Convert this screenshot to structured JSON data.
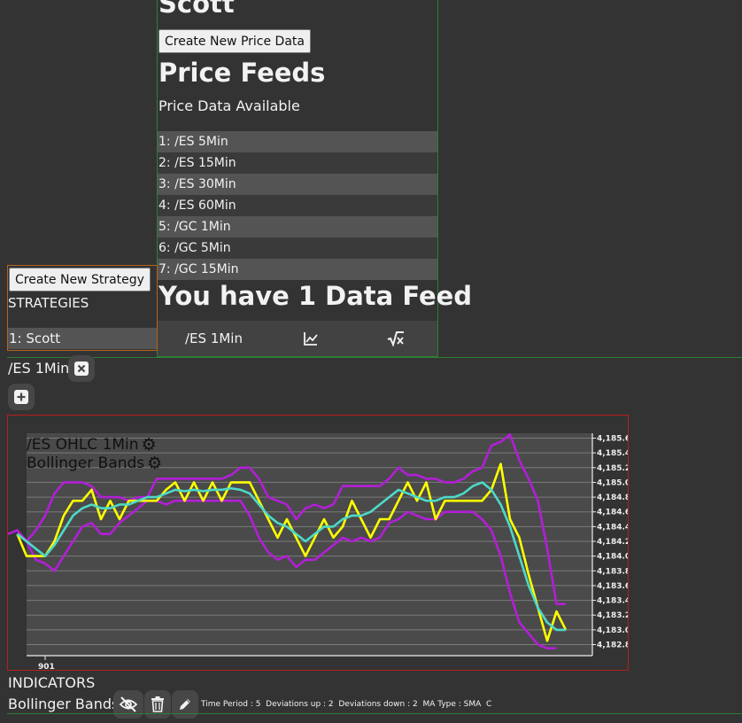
{
  "feeds": {
    "title_partial": "Scott",
    "create_button": "Create New Price Data",
    "heading": "Price Feeds",
    "subheading": "Price Data Available",
    "items": [
      "1: /ES 5Min",
      "2: /ES 15Min",
      "3: /ES 30Min",
      "4: /ES 60Min",
      "5: /GC 1Min",
      "6: /GC 5Min",
      "7: /GC 15Min"
    ],
    "count_heading": "You have 1 Data Feed",
    "active_feed": "/ES 1Min"
  },
  "strategies": {
    "create_button": "Create New Strategy",
    "heading": "STRATEGIES",
    "items": [
      "1: Scott"
    ]
  },
  "workspace": {
    "tab_label": "/ES 1Min"
  },
  "chart_labels": {
    "series_label": "/ES OHLC 1Min",
    "indicator_label": "Bollinger Bands",
    "x_tick": "901"
  },
  "indicators": {
    "heading": "INDICATORS",
    "name": "Bollinger Bands",
    "params": "Time Period : 5  Deviations up : 2  Deviations down : 2  MA Type : SMA  C"
  },
  "colors": {
    "price": "#ffff00",
    "middle": "#4dd9c8",
    "bands": "#b21fd6",
    "grid": "#7a7a7a",
    "plot_bg": "#4a4a4a"
  },
  "chart_data": {
    "type": "line",
    "yticks": [
      "4,185.6",
      "4,185.4",
      "4,185.2",
      "4,185.0",
      "4,184.8",
      "4,184.6",
      "4,184.4",
      "4,184.2",
      "4,184.0",
      "4,183.8",
      "4,183.6",
      "4,183.4",
      "4,183.2",
      "4,183.0",
      "4,182.8"
    ],
    "ylim": [
      4182.75,
      4185.65
    ],
    "xlim": [
      0,
      61
    ],
    "x_tick_value": 4,
    "series": [
      {
        "values": [
          4184.3,
          4184.0,
          4184.0,
          4184.0,
          4184.2,
          4184.55,
          4184.75,
          4184.75,
          4184.9,
          4184.5,
          4184.75,
          4184.5,
          4184.75,
          4184.75,
          4184.75,
          4184.75,
          4184.9,
          4185.0,
          4184.75,
          4185.0,
          4184.75,
          4185.0,
          4184.75,
          4185.0,
          4185.0,
          4185.0,
          4184.75,
          4184.5,
          4184.25,
          4184.5,
          4184.25,
          4184.0,
          4184.25,
          4184.5,
          4184.25,
          4184.4,
          4184.75,
          4184.5,
          4184.25,
          4184.5,
          4184.5,
          4184.75,
          4185.0,
          4184.75,
          4185.0,
          4184.5,
          4184.75,
          4184.75,
          4184.75,
          4184.75,
          4184.75,
          4184.9,
          4185.25,
          4184.5,
          4184.25,
          4183.75,
          4183.3,
          4182.85,
          4183.25,
          4183.0
        ],
        "x_start": 1
      },
      {
        "values": [
          4184.3,
          4184.2,
          4184.1,
          4184.0,
          4184.15,
          4184.35,
          4184.55,
          4184.65,
          4184.7,
          4184.65,
          4184.65,
          4184.7,
          4184.7,
          4184.75,
          4184.8,
          4184.8,
          4184.85,
          4184.9,
          4184.88,
          4184.9,
          4184.88,
          4184.9,
          4184.9,
          4184.92,
          4184.9,
          4184.85,
          4184.7,
          4184.55,
          4184.45,
          4184.4,
          4184.3,
          4184.2,
          4184.3,
          4184.4,
          4184.4,
          4184.5,
          4184.55,
          4184.55,
          4184.6,
          4184.7,
          4184.8,
          4184.9,
          4184.85,
          4184.8,
          4184.75,
          4184.75,
          4184.8,
          4184.8,
          4184.85,
          4184.95,
          4185.0,
          4184.9,
          4184.7,
          4184.4,
          4184.0,
          4183.6,
          4183.3,
          4183.1,
          4183.0,
          4183.0
        ],
        "x_start": 1
      },
      {
        "values": [
          4184.3,
          4184.35,
          4184.2,
          4184.35,
          4184.55,
          4184.85,
          4185.0,
          4185.0,
          4185.0,
          4184.95,
          4184.8,
          4184.8,
          4184.8,
          4184.75,
          4184.8,
          4184.8,
          4185.05,
          4185.05,
          4185.05,
          4185.05,
          4185.05,
          4185.05,
          4185.05,
          4185.05,
          4185.1,
          4185.2,
          4185.2,
          4185.05,
          4184.8,
          4184.75,
          4184.7,
          4184.5,
          4184.65,
          4184.7,
          4184.65,
          4184.7,
          4184.95,
          4184.95,
          4184.95,
          4184.95,
          4184.95,
          4185.05,
          4185.2,
          4185.1,
          4185.1,
          4185.05,
          4185.05,
          4185.0,
          4185.0,
          4185.05,
          4185.15,
          4185.2,
          4185.5,
          4185.55,
          4185.65,
          4185.3,
          4185.05,
          4184.75,
          4184.1,
          4183.35,
          4183.35
        ],
        "x_start": 0
      },
      {
        "values": [
          4184.3,
          4184.2,
          4183.95,
          4183.9,
          4183.8,
          4184.0,
          4184.2,
          4184.4,
          4184.45,
          4184.3,
          4184.3,
          4184.45,
          4184.55,
          4184.65,
          4184.75,
          4184.75,
          4184.7,
          4184.75,
          4184.75,
          4184.75,
          4184.75,
          4184.75,
          4184.75,
          4184.75,
          4184.75,
          4184.55,
          4184.25,
          4184.05,
          4183.95,
          4184.0,
          4183.85,
          4183.95,
          4183.95,
          4184.05,
          4184.15,
          4184.25,
          4184.2,
          4184.25,
          4184.2,
          4184.25,
          4184.45,
          4184.5,
          4184.6,
          4184.55,
          4184.5,
          4184.5,
          4184.6,
          4184.6,
          4184.6,
          4184.6,
          4184.5,
          4184.35,
          4184.0,
          4183.5,
          4183.1,
          4182.95,
          4182.8,
          4182.75,
          4182.75
        ],
        "x_start": 1
      }
    ]
  }
}
